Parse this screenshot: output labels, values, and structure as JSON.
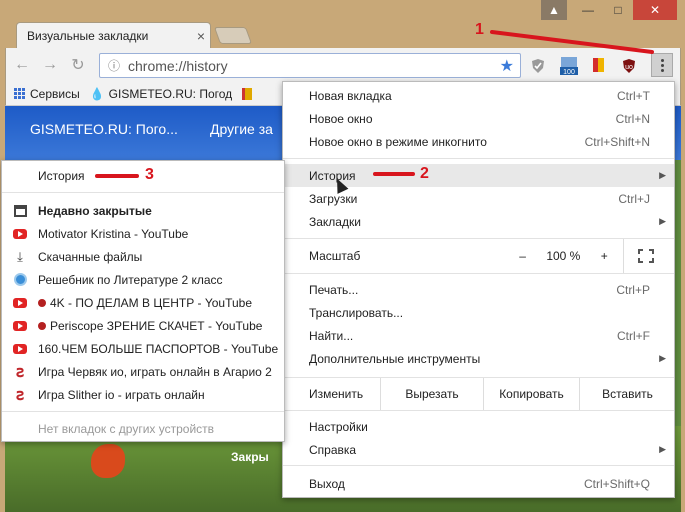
{
  "tab": {
    "title": "Визуальные закладки",
    "close": "×"
  },
  "window": {
    "user": "▲",
    "minimize": "—",
    "maximize": "□",
    "close": "✕"
  },
  "toolbar": {
    "back": "←",
    "forward": "→",
    "reload": "↻",
    "url": "chrome://history",
    "ext_badge": "100"
  },
  "bookmarks": [
    {
      "label": "Сервисы",
      "icon": "apps-icon"
    },
    {
      "label": "GISMETEO.RU: Погод",
      "icon": "drop-icon"
    }
  ],
  "page": {
    "banner_left": "GISMETEO.RU: Пого...",
    "banner_right": "Другие за",
    "bottom_label": "Закры"
  },
  "main_menu": {
    "new_tab": "Новая вкладка",
    "new_tab_sc": "Ctrl+T",
    "new_window": "Новое окно",
    "new_window_sc": "Ctrl+N",
    "incognito": "Новое окно в режиме инкогнито",
    "incognito_sc": "Ctrl+Shift+N",
    "history": "История",
    "downloads": "Загрузки",
    "downloads_sc": "Ctrl+J",
    "bookmarks": "Закладки",
    "zoom": "Масштаб",
    "zoom_minus": "–",
    "zoom_value": "100 %",
    "zoom_plus": "+",
    "print": "Печать...",
    "print_sc": "Ctrl+P",
    "cast": "Транслировать...",
    "find": "Найти...",
    "find_sc": "Ctrl+F",
    "more_tools": "Дополнительные инструменты",
    "edit": "Изменить",
    "cut": "Вырезать",
    "copy": "Копировать",
    "paste": "Вставить",
    "settings": "Настройки",
    "help": "Справка",
    "exit": "Выход",
    "exit_sc": "Ctrl+Shift+Q"
  },
  "history_menu": {
    "history": "История",
    "recently_closed": "Недавно закрытые",
    "items": [
      "Motivator Kristina - YouTube",
      "Скачанные файлы",
      "Решебник по Литературе 2 класс",
      "4K - ПО ДЕЛАМ В ЦЕНТР - YouTube",
      "Periscope ЗРЕНИЕ СКАЧЕТ - YouTube",
      "160.ЧЕМ БОЛЬШЕ ПАСПОРТОВ - YouTube",
      "Игра Червяк ио, играть онлайн в Агарио 2",
      "Игра Slither io - играть онлайн"
    ],
    "no_tabs": "Нет вкладок с других устройств"
  },
  "annotations": {
    "one": "1",
    "two": "2",
    "three": "3"
  },
  "colors": {
    "accent_red": "#d8151d",
    "youtube_red": "#e12424",
    "banner_blue": "#1e5bc7"
  }
}
